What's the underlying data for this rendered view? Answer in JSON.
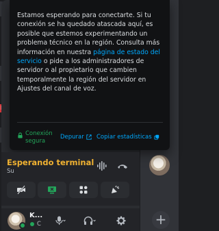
{
  "tooltip": {
    "message_part1": "Estamos esperando para conectarte. Si tu conexión se ha quedado atascada aquí, es posible que estemos experimentando un problema técnico en la región. Consulta más información en nuestra ",
    "status_link": "página de estado del servicio",
    "message_part2": " o pide a los administradores de servidor o al propietario que cambien temporalmente la región del servidor en Ajustes del canal de voz.",
    "secure_label": "Conexión segura",
    "debug_label": "Depurar",
    "stats_label": "Copiar estadísticas"
  },
  "voice": {
    "status": "Esperando terminal",
    "subtext": "Su"
  },
  "user": {
    "name": "K...",
    "status": "C"
  },
  "rail": {
    "dm_badge": "M"
  },
  "colors": {
    "status_warning": "#f0b232",
    "link": "#00a8fc",
    "secure_green": "#23a55a",
    "danger": "#da373c"
  }
}
